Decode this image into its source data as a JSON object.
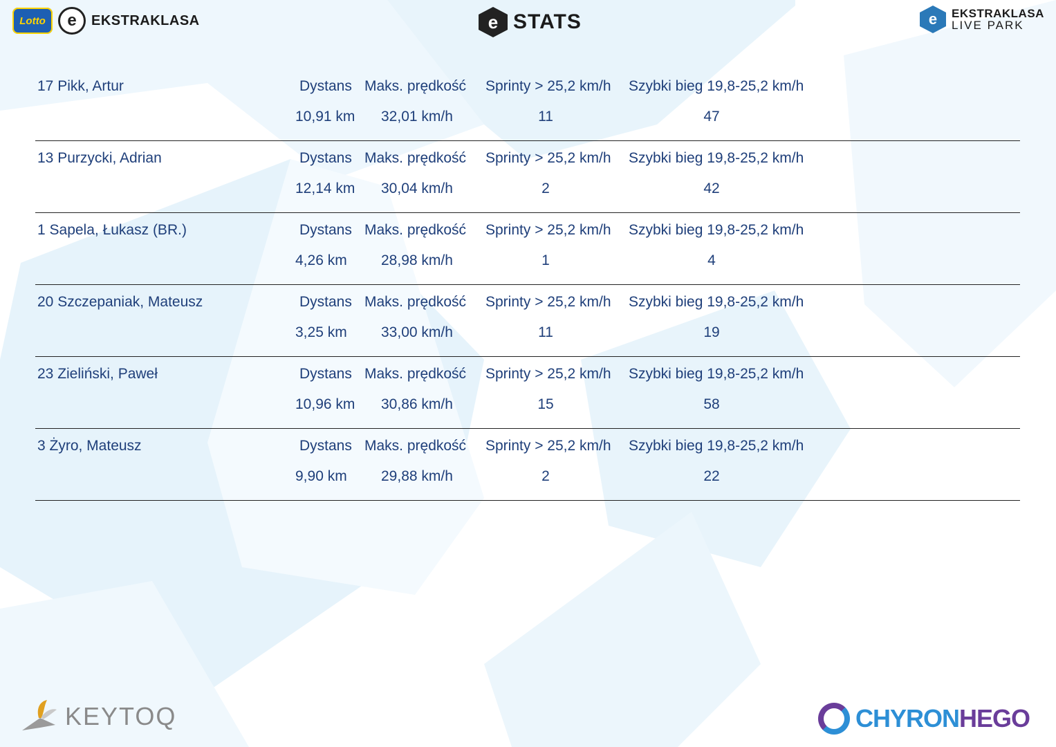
{
  "header": {
    "lotto_label": "Lotto",
    "league_label": "EKSTRAKLASA",
    "stats_label": "STATS",
    "livepark_top": "EKSTRAKLASA",
    "livepark_bottom": "LIVE PARK"
  },
  "columns": {
    "distance": "Dystans",
    "max_speed": "Maks. prędkość",
    "sprints": "Sprinty > 25,2 km/h",
    "fast_run": "Szybki bieg 19,8-25,2 km/h"
  },
  "players": [
    {
      "name": "17  Pikk, Artur",
      "distance": "10,91 km",
      "max_speed": "32,01 km/h",
      "sprints": "11",
      "fast_run": "47"
    },
    {
      "name": "13  Purzycki, Adrian",
      "distance": "12,14 km",
      "max_speed": "30,04 km/h",
      "sprints": "2",
      "fast_run": "42"
    },
    {
      "name": "1  Sapela, Łukasz (BR.)",
      "distance": "4,26 km",
      "max_speed": "28,98 km/h",
      "sprints": "1",
      "fast_run": "4"
    },
    {
      "name": "20  Szczepaniak, Mateusz",
      "distance": "3,25 km",
      "max_speed": "33,00 km/h",
      "sprints": "11",
      "fast_run": "19"
    },
    {
      "name": "23  Zieliński, Paweł",
      "distance": "10,96 km",
      "max_speed": "30,86 km/h",
      "sprints": "15",
      "fast_run": "58"
    },
    {
      "name": "3  Żyro, Mateusz",
      "distance": "9,90 km",
      "max_speed": "29,88 km/h",
      "sprints": "2",
      "fast_run": "22"
    }
  ],
  "footer": {
    "keytoq_label": "KEYTOQ",
    "chyron_label": "CHYRON",
    "hego_label": "HEGO"
  },
  "colors": {
    "text": "#1f3f7a",
    "watermark": "#e6f3fb",
    "rule": "#222222"
  }
}
